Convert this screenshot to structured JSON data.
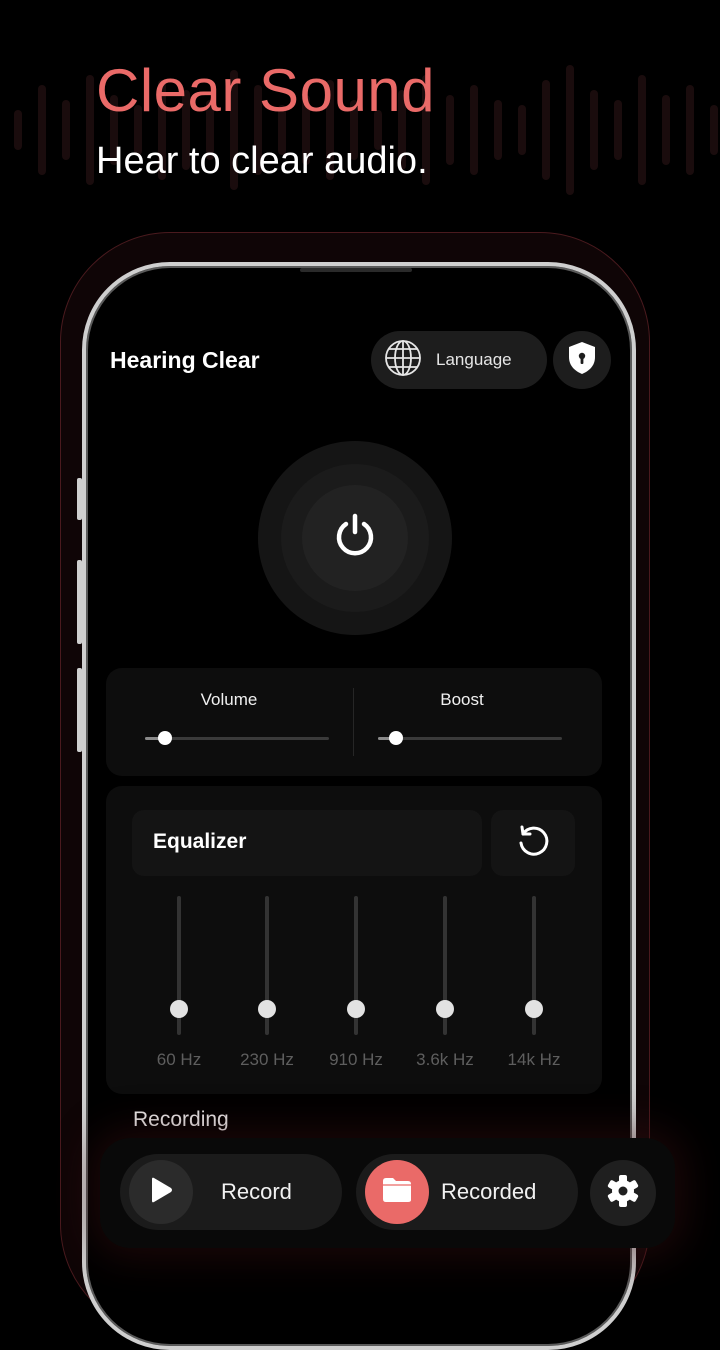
{
  "promo": {
    "headline": "Clear Sound",
    "subheadline": "Hear to clear audio."
  },
  "colors": {
    "accent": "#ea6a68",
    "background": "#000000",
    "card": "#0d0d0d",
    "button_dark": "#1d1d1d"
  },
  "header": {
    "app_title": "Hearing Clear",
    "language_label": "Language",
    "language_icon": "globe-icon",
    "privacy_icon": "shield-lock-icon"
  },
  "power": {
    "icon": "power-icon",
    "state": "off"
  },
  "sliders": [
    {
      "label": "Volume",
      "value": 0.11
    },
    {
      "label": "Boost",
      "value": 0.1
    }
  ],
  "equalizer": {
    "title": "Equalizer",
    "reset_icon": "reset-icon",
    "bands": [
      {
        "label": "60 Hz",
        "value": 0.0
      },
      {
        "label": "230 Hz",
        "value": 0.0
      },
      {
        "label": "910 Hz",
        "value": 0.0
      },
      {
        "label": "3.6k Hz",
        "value": 0.0
      },
      {
        "label": "14k Hz",
        "value": 0.0
      }
    ]
  },
  "recording": {
    "section_label": "Recording",
    "record_label": "Record",
    "record_icon": "play-icon",
    "recorded_label": "Recorded",
    "recorded_icon": "folder-icon",
    "settings_icon": "gear-icon"
  }
}
